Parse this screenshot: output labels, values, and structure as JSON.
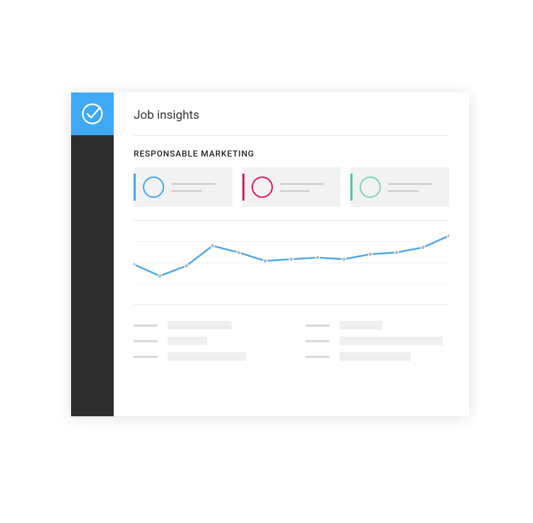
{
  "sidebar": {
    "logo": "checkmark-circle"
  },
  "header": {
    "title": "Job insights"
  },
  "section": {
    "title": "RESPONSABLE MARKETING"
  },
  "kpis": [
    {
      "accent_color": "#3fa9f5",
      "circle_color": "#3fa9f5"
    },
    {
      "accent_color": "#d81b60",
      "circle_color": "#d81b60"
    },
    {
      "accent_color": "#4fc9a0",
      "circle_color": "#7fd6b8"
    }
  ],
  "chart_data": {
    "type": "line",
    "title": "",
    "xlabel": "",
    "ylabel": "",
    "x": [
      0,
      1,
      2,
      3,
      4,
      5,
      6,
      7,
      8,
      9,
      10,
      11,
      12
    ],
    "values": [
      48,
      34,
      46,
      70,
      62,
      52,
      54,
      56,
      54,
      60,
      62,
      68,
      82
    ],
    "ylim": [
      0,
      100
    ],
    "line_color": "#4fa8e8",
    "point_color": "#bdbdbd"
  },
  "details": {
    "left": [
      {
        "value_width": 90
      },
      {
        "value_width": 55
      },
      {
        "value_width": 110
      }
    ],
    "right": [
      {
        "value_width": 60
      },
      {
        "value_width": 145
      },
      {
        "value_width": 100
      }
    ]
  }
}
